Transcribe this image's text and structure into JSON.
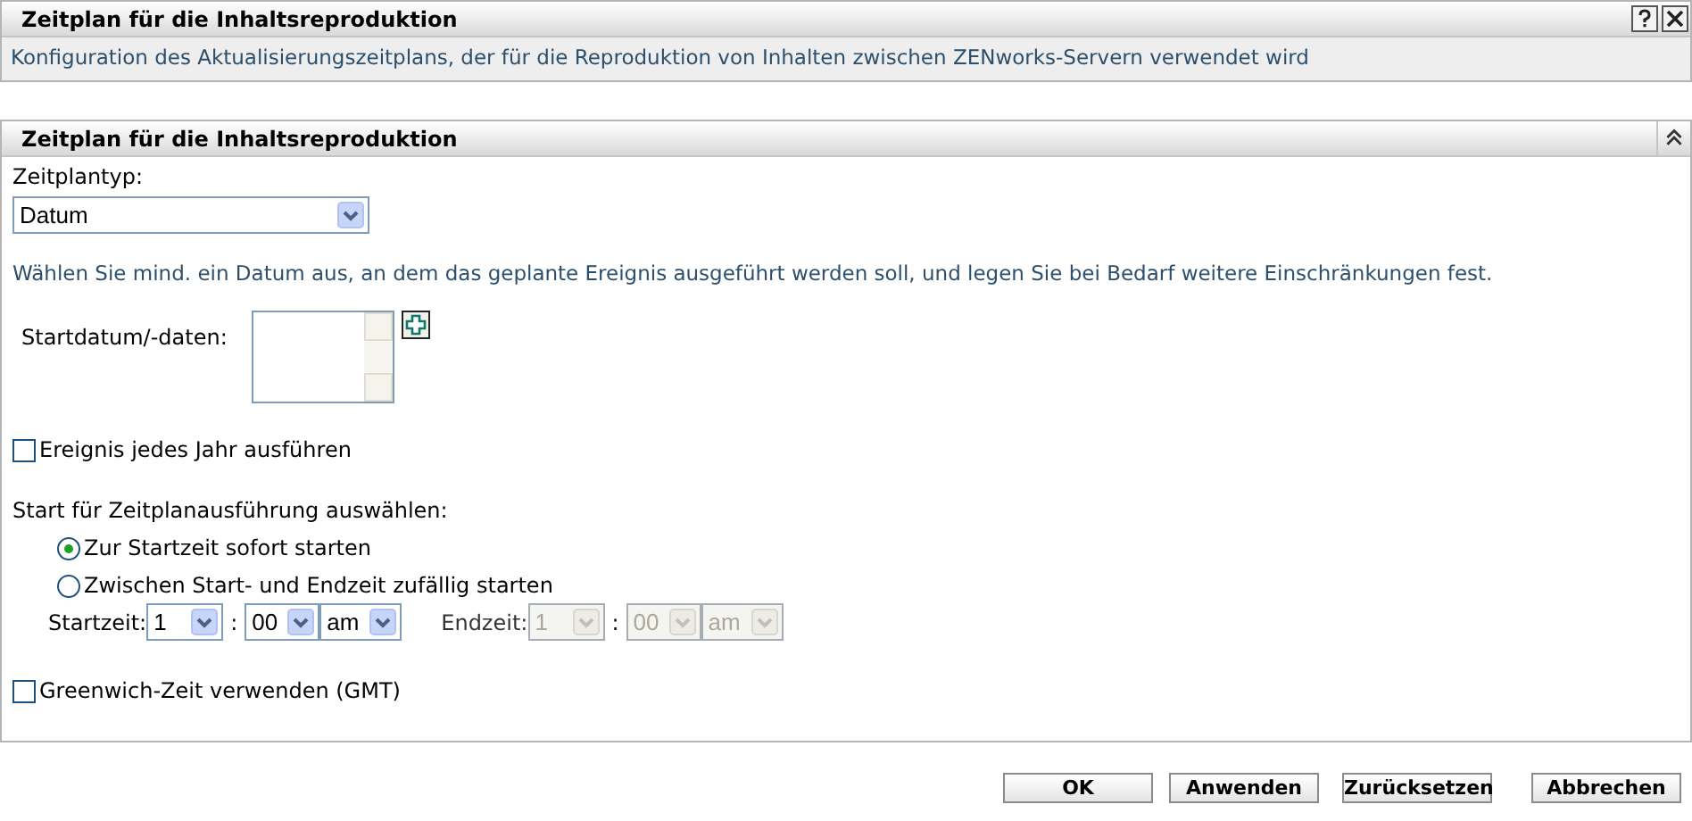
{
  "header": {
    "title": "Zeitplan für die Inhaltsreproduktion",
    "description": "Konfiguration des Aktualisierungszeitplans, der für die Reproduktion von Inhalten zwischen ZENworks-Servern verwendet wird"
  },
  "section": {
    "title": "Zeitplan für die Inhaltsreproduktion",
    "schedule_type": {
      "label": "Zeitplantyp:",
      "value": "Datum"
    },
    "instruction": "Wählen Sie mind. ein Datum aus, an dem das geplante Ereignis ausgeführt werden soll, und legen Sie bei Bedarf weitere Einschränkungen fest.",
    "start_dates": {
      "label": "Startdatum/-daten:"
    },
    "yearly": {
      "label": "Ereignis jedes Jahr ausführen",
      "checked": false
    },
    "start_mode": {
      "label": "Start für Zeitplanausführung auswählen:",
      "options": [
        {
          "label": "Zur Startzeit sofort starten",
          "selected": true
        },
        {
          "label": "Zwischen Start- und Endzeit zufällig starten",
          "selected": false
        }
      ]
    },
    "times": [
      {
        "label": "Startzeit:",
        "hour": "1",
        "separator": ":",
        "minute": "00",
        "ampm": "am",
        "disabled": false
      },
      {
        "label": "Endzeit:",
        "hour": "1",
        "separator": ":",
        "minute": "00",
        "ampm": "am",
        "disabled": true
      }
    ],
    "gmt": {
      "label": "Greenwich-Zeit verwenden (GMT)",
      "checked": false
    }
  },
  "buttons": [
    "OK",
    "Anwenden",
    "Zurücksetzen",
    "Abbrechen"
  ]
}
